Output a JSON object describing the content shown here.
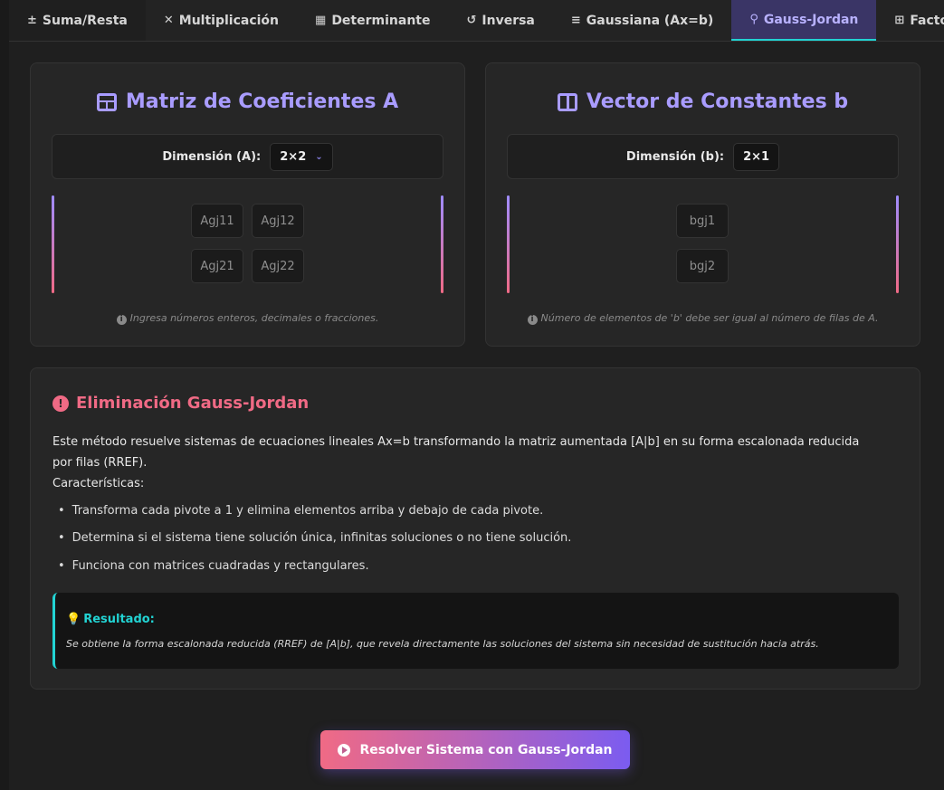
{
  "tabs": [
    {
      "icon": "±",
      "label": "Suma/Resta"
    },
    {
      "icon": "✕",
      "label": "Multiplicación"
    },
    {
      "icon": "▦",
      "label": "Determinante"
    },
    {
      "icon": "↺",
      "label": "Inversa"
    },
    {
      "icon": "≡",
      "label": "Gaussiana (Ax=b)"
    },
    {
      "icon": "⚲",
      "label": "Gauss-Jordan"
    },
    {
      "icon": "⊞",
      "label": "Facto"
    }
  ],
  "matrix_a": {
    "title": "Matriz de Coeficientes A",
    "dim_label": "Dimensión (A):",
    "dim_value": "2×2",
    "cells": [
      "Agj11",
      "Agj12",
      "Agj21",
      "Agj22"
    ],
    "hint": "Ingresa números enteros, decimales o fracciones."
  },
  "vector_b": {
    "title": "Vector de Constantes b",
    "dim_label": "Dimensión (b):",
    "dim_value": "2×1",
    "cells": [
      "bgj1",
      "bgj2"
    ],
    "hint": "Número de elementos de 'b' debe ser igual al número de filas de A."
  },
  "info": {
    "title": "Eliminación Gauss-Jordan",
    "description": "Este método resuelve sistemas de ecuaciones lineales Ax=b transformando la matriz aumentada [A|b] en su forma escalonada reducida por filas (RREF).",
    "features_label": "Características:",
    "features": [
      "Transforma cada pivote a 1 y elimina elementos arriba y debajo de cada pivote.",
      "Determina si el sistema tiene solución única, infinitas soluciones o no tiene solución.",
      "Funciona con matrices cuadradas y rectangulares."
    ],
    "result_title": "Resultado:",
    "result_text": "Se obtiene la forma escalonada reducida (RREF) de [A|b], que revela directamente las soluciones del sistema sin necesidad de sustitución hacia atrás."
  },
  "solve_button": "Resolver Sistema con Gauss-Jordan",
  "colors": {
    "accent_purple": "#a99cff",
    "accent_pink": "#f06a85",
    "accent_cyan": "#22d3d3"
  }
}
